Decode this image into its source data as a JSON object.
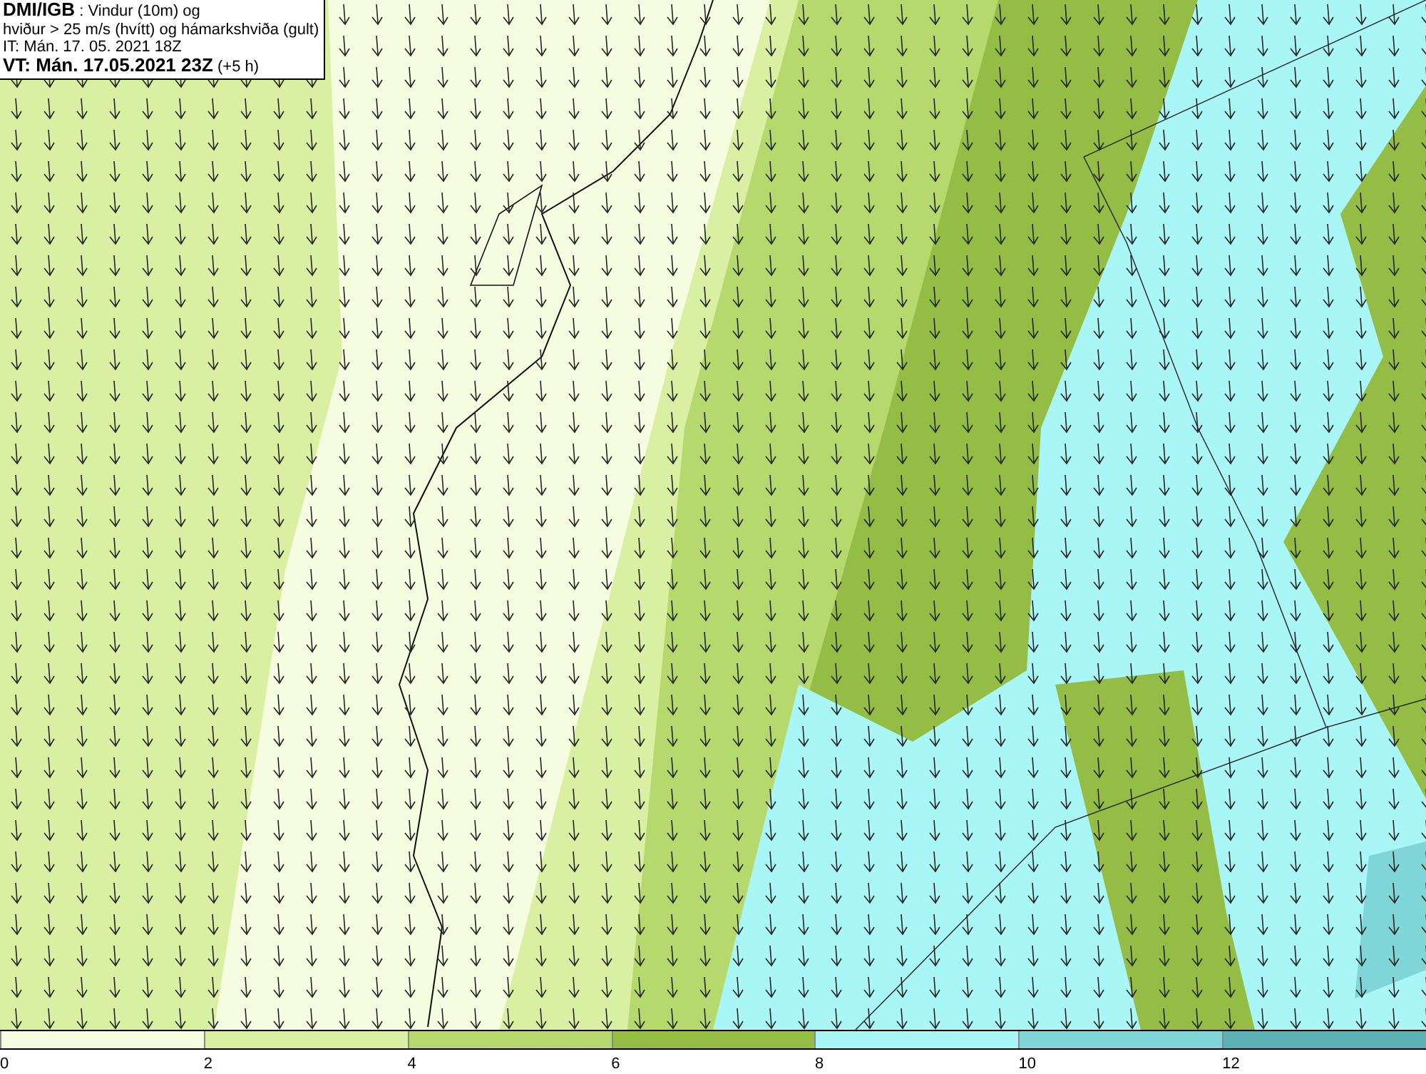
{
  "caption": {
    "lines": [
      "**DMI/IGB** : Vindur (10m) og",
      "hviður > 25 m/s (hvítt) og hámarkshviða (gult)",
      "IT: Mán. 17. 05. 2021 18Z",
      "**VT: Mán. 17.05.2021 23Z** (+5 h)"
    ]
  },
  "legend": {
    "bands": [
      {
        "label": "0",
        "color": "#f6fcdf"
      },
      {
        "label": "2",
        "color": "#d9f0a3"
      },
      {
        "label": "4",
        "color": "#b6d96e"
      },
      {
        "label": "6",
        "color": "#93bd44"
      },
      {
        "label": "8",
        "color": "#a9f6f6"
      },
      {
        "label": "10",
        "color": "#80d6d6"
      },
      {
        "label": "12",
        "color": "#5bb1b3"
      }
    ]
  }
}
